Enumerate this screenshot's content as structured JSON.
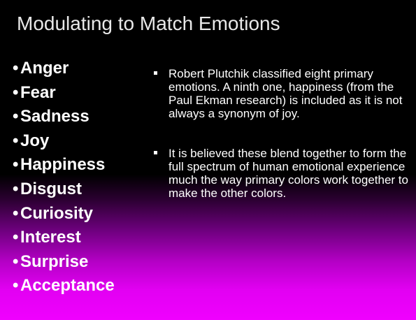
{
  "slide": {
    "title": "Modulating to Match Emotions",
    "emotion_bullet": "•",
    "emotions": [
      "Anger",
      "Fear",
      "Sadness",
      "Joy",
      "Happiness",
      "Disgust",
      "Curiosity",
      "Interest",
      "Surprise",
      "Acceptance"
    ],
    "points": [
      "Robert Plutchik classified eight primary emotions. A ninth one, happiness (from the Paul Ekman research) is included as it is not always a synonym of joy.",
      "It is believed these blend together to form the full spectrum of human emotional experience much the way primary colors work together to make the other colors."
    ]
  },
  "colors": {
    "background_top": "#000000",
    "background_bottom": "#f000ff",
    "title_text": "#e8e8e8",
    "body_text": "#ffffff"
  }
}
